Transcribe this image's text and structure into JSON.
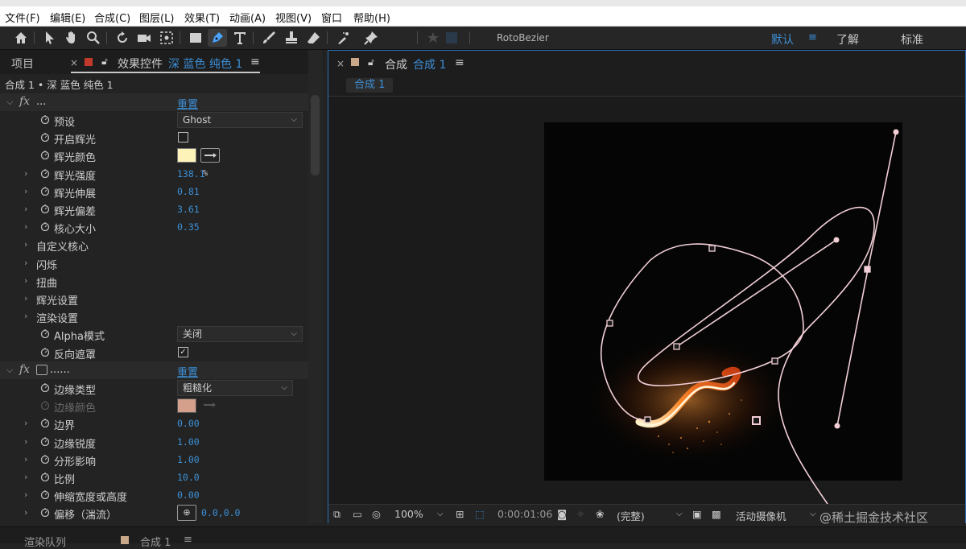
{
  "menubar": {
    "items": [
      {
        "label": "文件(F)"
      },
      {
        "label": "编辑(E)"
      },
      {
        "label": "合成(C)"
      },
      {
        "label": "图层(L)"
      },
      {
        "label": "效果(T)"
      },
      {
        "label": "动画(A)"
      },
      {
        "label": "视图(V)"
      },
      {
        "label": "窗口"
      },
      {
        "label": "帮助(H)"
      }
    ]
  },
  "toolbar": {
    "rotobezier_label": "RotoBezier",
    "workspaces": {
      "default": "默认",
      "learn": "了解",
      "standard": "标准"
    }
  },
  "left_panel": {
    "tab_project": "项目",
    "tab_effects_prefix": "效果控件",
    "tab_effects_layer": "深 蓝色 纯色 1",
    "layer_path": "合成 1 • 深 蓝色 纯色 1",
    "effect1": {
      "name": "...",
      "reset": "重置",
      "rows": [
        {
          "label": "预设",
          "dropdown": "Ghost"
        },
        {
          "label": "开启辉光",
          "checked": false
        },
        {
          "label": "辉光颜色",
          "color": "#fdf2b8"
        },
        {
          "label": "辉光强度",
          "value": "138.1",
          "unit": "%"
        },
        {
          "label": "辉光伸展",
          "value": "0.81"
        },
        {
          "label": "辉光偏差",
          "value": "3.61"
        },
        {
          "label": "核心大小",
          "value": "0.35"
        },
        {
          "label": "自定义核心"
        },
        {
          "label": "闪烁"
        },
        {
          "label": "扭曲"
        },
        {
          "label": "辉光设置"
        },
        {
          "label": "渲染设置"
        },
        {
          "label": "Alpha模式",
          "dropdown": "关闭"
        },
        {
          "label": "反向遮罩",
          "checked": true
        }
      ]
    },
    "effect2": {
      "name": "......",
      "reset": "重置",
      "rows": [
        {
          "label": "边缘类型",
          "dropdown": "粗糙化"
        },
        {
          "label": "边缘颜色",
          "color": "#d4a08c"
        },
        {
          "label": "边界",
          "value": "0.00"
        },
        {
          "label": "边缘锐度",
          "value": "1.00"
        },
        {
          "label": "分形影响",
          "value": "1.00"
        },
        {
          "label": "比例",
          "value": "10.0"
        },
        {
          "label": "伸缩宽度或高度",
          "value": "0.00"
        },
        {
          "label": "偏移（湍流）",
          "value": "0.0,0.0"
        }
      ]
    }
  },
  "comp_panel": {
    "tab_prefix": "合成",
    "tab_name": "合成 1",
    "breadcrumb": "合成 1",
    "viewbar": {
      "zoom": "100%",
      "timecode": "0:00:01:06",
      "resolution": "(完整)",
      "camera": "活动摄像机"
    }
  },
  "bottom_panel": {
    "tab_render_queue": "渲染队列",
    "tab_comp": "合成 1"
  },
  "watermark": "@稀土掘金技术社区",
  "colors": {
    "accent_blue": "#3d8fd6",
    "path_pink": "#f2cfd6",
    "selected_border": "#2d6fb7"
  }
}
